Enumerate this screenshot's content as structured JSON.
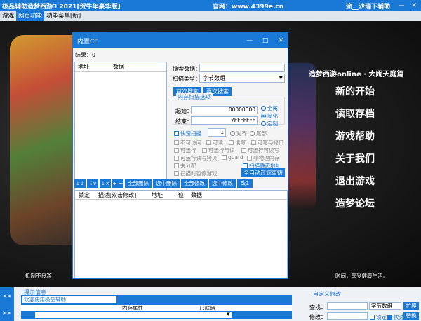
{
  "titlebar": {
    "app": "极品辅助造梦西游3 2021[贺牛年豪华版]",
    "site": "官网：www.4399e.cn",
    "slogan": "流__沙瑞下辅助"
  },
  "menubar": {
    "items": [
      "游戏",
      "网页功能",
      "功能菜单[新]"
    ]
  },
  "game": {
    "title": "造梦西游online · 大闹天庭篇",
    "menu": [
      "新的开始",
      "读取存档",
      "游戏帮助",
      "关于我们",
      "退出游戏",
      "造梦论坛"
    ],
    "footer_left": "抵制不良游",
    "footer_right": "时间，享受健康生活。"
  },
  "ce": {
    "title": "内置CE",
    "result": "结果：0",
    "list_headers": [
      "地址",
      "数据"
    ],
    "search_label": "搜索数据：",
    "scan_type_label": "扫描类型：",
    "scan_type_value": "字节数组",
    "first_scan": "首次搜索",
    "next_scan": "再次搜索",
    "mem_group": "内存扫描选项",
    "start_label": "起始：",
    "start_value": "00000000",
    "end_label": "结束：",
    "end_value": "7FFFFFFF",
    "radio_all": "全属",
    "radio_simple": "简化",
    "radio_custom": "定制",
    "fast_scan": "快速扫描",
    "fast_value": "1",
    "align": "对齐",
    "tail": "尾部",
    "opts1": [
      "不可访问",
      "可读",
      "读写",
      "可写与拷贝"
    ],
    "opts2": [
      "可运行",
      "可运行与读",
      "可运行可读写"
    ],
    "opts3": [
      "可运行读写拷贝",
      "guard",
      "非物理内存"
    ],
    "opts4": [
      "未分配"
    ],
    "scan_static": "扫描静态地址",
    "pause_game": "扫描时暂停游戏",
    "auto_filter": "全自动过滤重铸",
    "bar_buttons": [
      "↓↓",
      "↓v",
      "↓×",
      "+ +",
      "全部删除",
      "选中删除",
      "全部修改",
      "选中修改",
      "改1"
    ],
    "list2_headers": [
      "锁定",
      "描述[双击修改]",
      "地址",
      "位",
      "数据"
    ]
  },
  "bottom": {
    "nav_up": "<<",
    "nav_down": ">>",
    "tip_title": "提示信息",
    "welcome": "欢迎使用极品辅助",
    "cols": [
      "内存属性",
      "已就绪"
    ],
    "custom_title": "自定义修改",
    "search_label": "查找：",
    "type_value": "字节数组",
    "expand": "扩展",
    "modify_label": "修改：",
    "lock": "锁定",
    "fast": "快速",
    "replace": "替换"
  }
}
